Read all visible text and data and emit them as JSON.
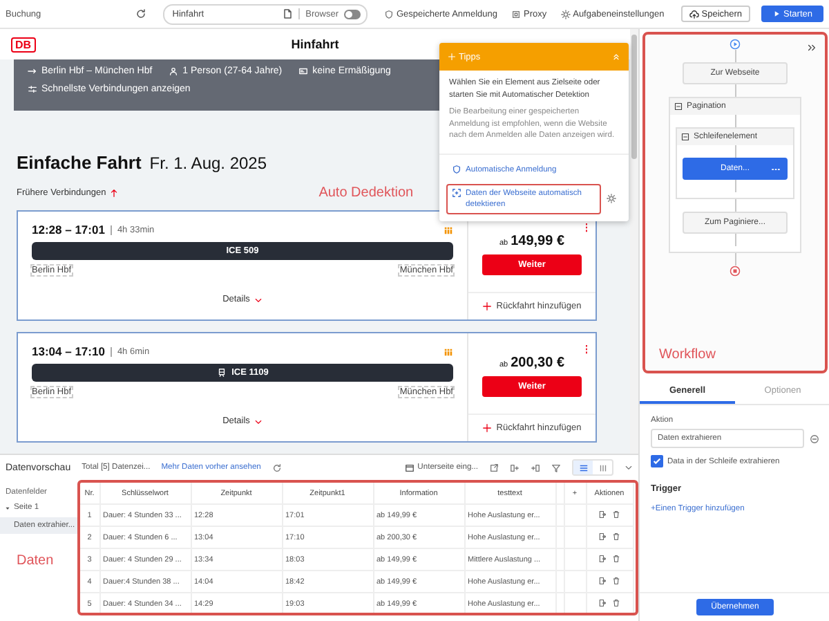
{
  "toolbar": {
    "title": "Buchung",
    "address": {
      "value": "Hinfahrt"
    },
    "browser_toggle": {
      "label": "Browser",
      "on": false
    },
    "actions": [
      "Gespeicherte Anmeldung",
      "Proxy",
      "Aufgabeneinstellungen"
    ],
    "save_button": "Speichern",
    "start_button": "Starten"
  },
  "page": {
    "logo": "DB",
    "title": "Hinfahrt",
    "route": "Berlin Hbf – München Hbf",
    "passengers": "1 Person (27-64 Jahre)",
    "discount": "keine Ermäßigung",
    "fastest_link": "Schnellste Verbindungen anzeigen",
    "heading": "Einfache Fahrt",
    "date": "Fr. 1. Aug. 2025",
    "earlier_link": "Frühere Verbindungen",
    "annotation": "Auto Dedektion",
    "connections": [
      {
        "time": "12:28 – 17:01",
        "duration": "4h 33min",
        "train": "ICE 509",
        "train_icon": false,
        "from": "Berlin Hbf",
        "to": "München Hbf",
        "details": "Details",
        "price_prefix": "ab",
        "price": "149,99 €",
        "button": "Weiter",
        "return_link": "Rückfahrt hinzufügen"
      },
      {
        "time": "13:04 – 17:10",
        "duration": "4h 6min",
        "train": "ICE 1109",
        "train_icon": true,
        "from": "Berlin Hbf",
        "to": "München Hbf",
        "details": "Details",
        "price_prefix": "ab",
        "price": "200,30 €",
        "button": "Weiter",
        "return_link": "Rückfahrt hinzufügen"
      }
    ]
  },
  "tips": {
    "title": "Tipps",
    "paragraphs": [
      "Wählen Sie ein Element aus Zielseite oder starten Sie mit Automatischer Detektion",
      "Die Bearbeitung einer gespeicherten Anmeldung ist empfohlen, wenn die Website nach dem Anmelden alle Daten anzeigen wird."
    ],
    "items": [
      {
        "kind": "login",
        "label": "Automatische Anmeldung",
        "highlighted": false
      },
      {
        "kind": "detect",
        "label": "Daten der Webseite automatisch detektieren",
        "highlighted": true
      }
    ]
  },
  "workflow": {
    "annotation": "Workflow",
    "steps": [
      {
        "kind": "step",
        "label": "Zur Webseite",
        "selected": false
      },
      {
        "kind": "group",
        "label": "Pagination",
        "expanded": true,
        "children": [
          {
            "kind": "group",
            "label": "Schleifenelement",
            "expanded": true,
            "children": [
              {
                "kind": "step",
                "label": "Daten...",
                "selected": true
              }
            ]
          },
          {
            "kind": "step",
            "label": "Zum Paginiere...",
            "selected": false
          }
        ]
      }
    ]
  },
  "settings": {
    "tabs": [
      {
        "label": "Generell",
        "selected": true
      },
      {
        "label": "Optionen",
        "selected": false
      }
    ],
    "action_label": "Aktion",
    "action_value": "Daten extrahieren",
    "loop_checkbox": {
      "label": "Data in der Schleife extrahieren",
      "checked": true
    },
    "trigger_heading": "Trigger",
    "add_trigger_link": "+Einen Trigger hinzufügen",
    "apply_button": "Übernehmen"
  },
  "data_preview": {
    "title": "Datenvorschau",
    "total": "Total [5] Datenzei...",
    "more_link": "Mehr Daten vorher ansehen",
    "subpage_button": "Unterseite eing...",
    "views": [
      {
        "kind": "list",
        "selected": true
      },
      {
        "kind": "columns",
        "selected": false
      }
    ],
    "fields_heading": "Datenfelder",
    "tree": [
      {
        "label": "Seite 1",
        "expanded": true,
        "children": [
          {
            "label": "Daten extrahier...",
            "selected": true
          }
        ]
      }
    ],
    "annotation": "Daten",
    "table": {
      "columns": [
        "Nr.",
        "Schlüsselwort",
        "Zeitpunkt",
        "Zeitpunkt1",
        "Information",
        "testtext"
      ],
      "add_column": "+",
      "actions_column": "Aktionen",
      "rows": [
        [
          "1",
          "Dauer: 4 Stunden 33 ...",
          "12:28",
          "17:01",
          "ab 149,99 €",
          "Hohe Auslastung er..."
        ],
        [
          "2",
          "Dauer: 4 Stunden 6 ...",
          "13:04",
          "17:10",
          "ab 200,30 €",
          "Hohe Auslastung er..."
        ],
        [
          "3",
          "Dauer: 4 Stunden 29 ...",
          "13:34",
          "18:03",
          "ab 149,99 €",
          "Mittlere Auslastung ..."
        ],
        [
          "4",
          "Dauer:4 Stunden 38 ...",
          "14:04",
          "18:42",
          "ab 149,99 €",
          "Hohe Auslastung er..."
        ],
        [
          "5",
          "Dauer: 4 Stunden 34 ...",
          "14:29",
          "19:03",
          "ab 149,99 €",
          "Hohe Auslastung er..."
        ]
      ]
    }
  }
}
